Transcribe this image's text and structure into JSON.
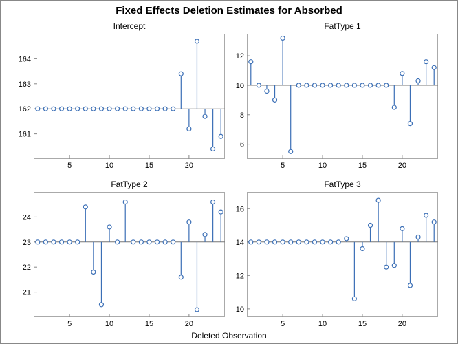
{
  "main_title": "Fixed Effects Deletion Estimates for Absorbed",
  "xaxis_label": "Deleted Observation",
  "chart_data": [
    {
      "type": "stem",
      "name": "Intercept",
      "title": "Intercept",
      "baseline": 162,
      "x": [
        1,
        2,
        3,
        4,
        5,
        6,
        7,
        8,
        9,
        10,
        11,
        12,
        13,
        14,
        15,
        16,
        17,
        18,
        19,
        20,
        21,
        22,
        23,
        24
      ],
      "values": [
        162,
        162,
        162,
        162,
        162,
        162,
        162,
        162,
        162,
        162,
        162,
        162,
        162,
        162,
        162,
        162,
        162,
        162,
        163.4,
        161.2,
        164.7,
        161.7,
        160.4,
        160.9
      ],
      "ylim": [
        160,
        165
      ],
      "yticks": [
        161,
        162,
        163,
        164
      ],
      "xlim": [
        0.5,
        24.5
      ],
      "xticks": [
        5,
        10,
        15,
        20
      ]
    },
    {
      "type": "stem",
      "name": "FatType 1",
      "title": "FatType 1",
      "baseline": 10,
      "x": [
        1,
        2,
        3,
        4,
        5,
        6,
        7,
        8,
        9,
        10,
        11,
        12,
        13,
        14,
        15,
        16,
        17,
        18,
        19,
        20,
        21,
        22,
        23,
        24
      ],
      "values": [
        11.6,
        10,
        9.6,
        9.0,
        13.2,
        5.5,
        10,
        10,
        10,
        10,
        10,
        10,
        10,
        10,
        10,
        10,
        10,
        10,
        8.5,
        10.8,
        7.4,
        10.3,
        11.6,
        11.2
      ],
      "ylim": [
        5,
        13.5
      ],
      "yticks": [
        6,
        8,
        10,
        12
      ],
      "xlim": [
        0.5,
        24.5
      ],
      "xticks": [
        5,
        10,
        15,
        20
      ]
    },
    {
      "type": "stem",
      "name": "FatType 2",
      "title": "FatType 2",
      "baseline": 23,
      "x": [
        1,
        2,
        3,
        4,
        5,
        6,
        7,
        8,
        9,
        10,
        11,
        12,
        13,
        14,
        15,
        16,
        17,
        18,
        19,
        20,
        21,
        22,
        23,
        24
      ],
      "values": [
        23,
        23,
        23,
        23,
        23,
        23,
        24.4,
        21.8,
        20.5,
        23.6,
        23,
        24.6,
        23,
        23,
        23,
        23,
        23,
        23,
        21.6,
        23.8,
        20.3,
        23.3,
        24.6,
        24.2
      ],
      "ylim": [
        20,
        25
      ],
      "yticks": [
        21,
        22,
        23,
        24
      ],
      "xlim": [
        0.5,
        24.5
      ],
      "xticks": [
        5,
        10,
        15,
        20
      ]
    },
    {
      "type": "stem",
      "name": "FatType 3",
      "title": "FatType 3",
      "baseline": 14,
      "x": [
        1,
        2,
        3,
        4,
        5,
        6,
        7,
        8,
        9,
        10,
        11,
        12,
        13,
        14,
        15,
        16,
        17,
        18,
        19,
        20,
        21,
        22,
        23,
        24
      ],
      "values": [
        14,
        14,
        14,
        14,
        14,
        14,
        14,
        14,
        14,
        14,
        14,
        14,
        14.2,
        10.6,
        13.6,
        15.0,
        16.5,
        12.5,
        12.6,
        14.8,
        11.4,
        14.3,
        15.6,
        15.2
      ],
      "ylim": [
        9.5,
        17
      ],
      "yticks": [
        10,
        12,
        14,
        16
      ],
      "xlim": [
        0.5,
        24.5
      ],
      "xticks": [
        5,
        10,
        15,
        20
      ]
    }
  ],
  "colors": {
    "stroke": "#3b6fb6",
    "marker_fill": "#ffffff",
    "tick": "#888888",
    "text": "#000000"
  }
}
